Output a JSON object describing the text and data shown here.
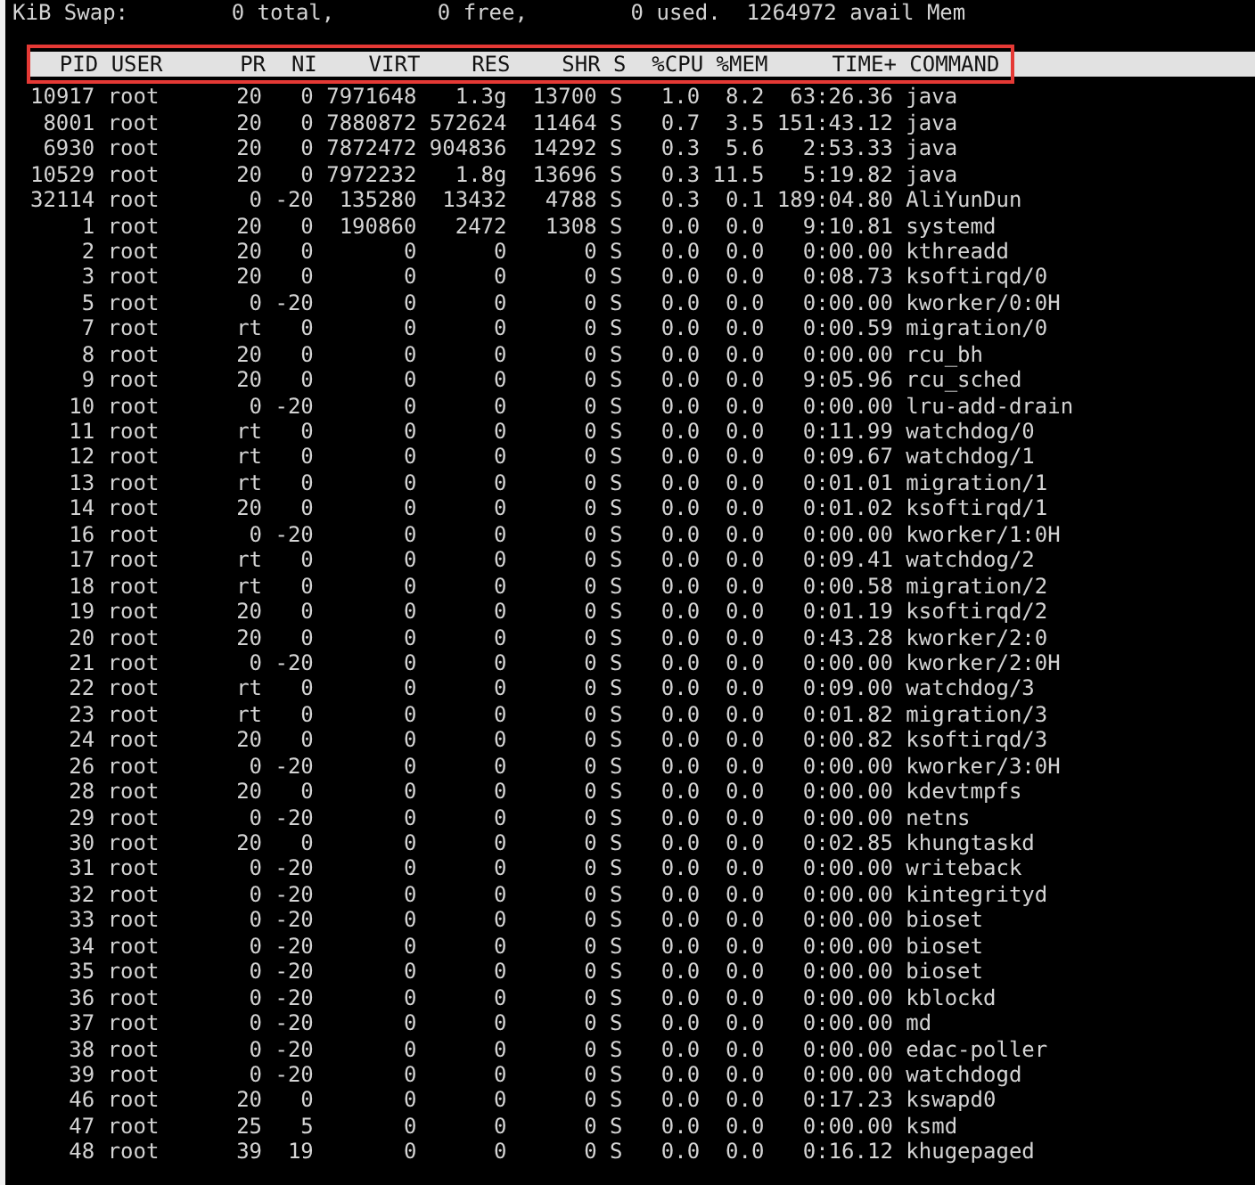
{
  "swap_line": "KiB Swap:        0 total,        0 free,        0 used.  1264972 avail Mem",
  "table": {
    "highlighted": true,
    "columns": [
      "PID",
      "USER",
      "PR",
      "NI",
      "VIRT",
      "RES",
      "SHR",
      "S",
      "%CPU",
      "%MEM",
      "TIME+",
      "COMMAND"
    ],
    "rows": [
      [
        "10917",
        "root",
        "20",
        "0",
        "7971648",
        "1.3g",
        "13700",
        "S",
        "1.0",
        "8.2",
        "63:26.36",
        "java"
      ],
      [
        "8001",
        "root",
        "20",
        "0",
        "7880872",
        "572624",
        "11464",
        "S",
        "0.7",
        "3.5",
        "151:43.12",
        "java"
      ],
      [
        "6930",
        "root",
        "20",
        "0",
        "7872472",
        "904836",
        "14292",
        "S",
        "0.3",
        "5.6",
        "2:53.33",
        "java"
      ],
      [
        "10529",
        "root",
        "20",
        "0",
        "7972232",
        "1.8g",
        "13696",
        "S",
        "0.3",
        "11.5",
        "5:19.82",
        "java"
      ],
      [
        "32114",
        "root",
        "0",
        "-20",
        "135280",
        "13432",
        "4788",
        "S",
        "0.3",
        "0.1",
        "189:04.80",
        "AliYunDun"
      ],
      [
        "1",
        "root",
        "20",
        "0",
        "190860",
        "2472",
        "1308",
        "S",
        "0.0",
        "0.0",
        "9:10.81",
        "systemd"
      ],
      [
        "2",
        "root",
        "20",
        "0",
        "0",
        "0",
        "0",
        "S",
        "0.0",
        "0.0",
        "0:00.00",
        "kthreadd"
      ],
      [
        "3",
        "root",
        "20",
        "0",
        "0",
        "0",
        "0",
        "S",
        "0.0",
        "0.0",
        "0:08.73",
        "ksoftirqd/0"
      ],
      [
        "5",
        "root",
        "0",
        "-20",
        "0",
        "0",
        "0",
        "S",
        "0.0",
        "0.0",
        "0:00.00",
        "kworker/0:0H"
      ],
      [
        "7",
        "root",
        "rt",
        "0",
        "0",
        "0",
        "0",
        "S",
        "0.0",
        "0.0",
        "0:00.59",
        "migration/0"
      ],
      [
        "8",
        "root",
        "20",
        "0",
        "0",
        "0",
        "0",
        "S",
        "0.0",
        "0.0",
        "0:00.00",
        "rcu_bh"
      ],
      [
        "9",
        "root",
        "20",
        "0",
        "0",
        "0",
        "0",
        "S",
        "0.0",
        "0.0",
        "9:05.96",
        "rcu_sched"
      ],
      [
        "10",
        "root",
        "0",
        "-20",
        "0",
        "0",
        "0",
        "S",
        "0.0",
        "0.0",
        "0:00.00",
        "lru-add-drain"
      ],
      [
        "11",
        "root",
        "rt",
        "0",
        "0",
        "0",
        "0",
        "S",
        "0.0",
        "0.0",
        "0:11.99",
        "watchdog/0"
      ],
      [
        "12",
        "root",
        "rt",
        "0",
        "0",
        "0",
        "0",
        "S",
        "0.0",
        "0.0",
        "0:09.67",
        "watchdog/1"
      ],
      [
        "13",
        "root",
        "rt",
        "0",
        "0",
        "0",
        "0",
        "S",
        "0.0",
        "0.0",
        "0:01.01",
        "migration/1"
      ],
      [
        "14",
        "root",
        "20",
        "0",
        "0",
        "0",
        "0",
        "S",
        "0.0",
        "0.0",
        "0:01.02",
        "ksoftirqd/1"
      ],
      [
        "16",
        "root",
        "0",
        "-20",
        "0",
        "0",
        "0",
        "S",
        "0.0",
        "0.0",
        "0:00.00",
        "kworker/1:0H"
      ],
      [
        "17",
        "root",
        "rt",
        "0",
        "0",
        "0",
        "0",
        "S",
        "0.0",
        "0.0",
        "0:09.41",
        "watchdog/2"
      ],
      [
        "18",
        "root",
        "rt",
        "0",
        "0",
        "0",
        "0",
        "S",
        "0.0",
        "0.0",
        "0:00.58",
        "migration/2"
      ],
      [
        "19",
        "root",
        "20",
        "0",
        "0",
        "0",
        "0",
        "S",
        "0.0",
        "0.0",
        "0:01.19",
        "ksoftirqd/2"
      ],
      [
        "20",
        "root",
        "20",
        "0",
        "0",
        "0",
        "0",
        "S",
        "0.0",
        "0.0",
        "0:43.28",
        "kworker/2:0"
      ],
      [
        "21",
        "root",
        "0",
        "-20",
        "0",
        "0",
        "0",
        "S",
        "0.0",
        "0.0",
        "0:00.00",
        "kworker/2:0H"
      ],
      [
        "22",
        "root",
        "rt",
        "0",
        "0",
        "0",
        "0",
        "S",
        "0.0",
        "0.0",
        "0:09.00",
        "watchdog/3"
      ],
      [
        "23",
        "root",
        "rt",
        "0",
        "0",
        "0",
        "0",
        "S",
        "0.0",
        "0.0",
        "0:01.82",
        "migration/3"
      ],
      [
        "24",
        "root",
        "20",
        "0",
        "0",
        "0",
        "0",
        "S",
        "0.0",
        "0.0",
        "0:00.82",
        "ksoftirqd/3"
      ],
      [
        "26",
        "root",
        "0",
        "-20",
        "0",
        "0",
        "0",
        "S",
        "0.0",
        "0.0",
        "0:00.00",
        "kworker/3:0H"
      ],
      [
        "28",
        "root",
        "20",
        "0",
        "0",
        "0",
        "0",
        "S",
        "0.0",
        "0.0",
        "0:00.00",
        "kdevtmpfs"
      ],
      [
        "29",
        "root",
        "0",
        "-20",
        "0",
        "0",
        "0",
        "S",
        "0.0",
        "0.0",
        "0:00.00",
        "netns"
      ],
      [
        "30",
        "root",
        "20",
        "0",
        "0",
        "0",
        "0",
        "S",
        "0.0",
        "0.0",
        "0:02.85",
        "khungtaskd"
      ],
      [
        "31",
        "root",
        "0",
        "-20",
        "0",
        "0",
        "0",
        "S",
        "0.0",
        "0.0",
        "0:00.00",
        "writeback"
      ],
      [
        "32",
        "root",
        "0",
        "-20",
        "0",
        "0",
        "0",
        "S",
        "0.0",
        "0.0",
        "0:00.00",
        "kintegrityd"
      ],
      [
        "33",
        "root",
        "0",
        "-20",
        "0",
        "0",
        "0",
        "S",
        "0.0",
        "0.0",
        "0:00.00",
        "bioset"
      ],
      [
        "34",
        "root",
        "0",
        "-20",
        "0",
        "0",
        "0",
        "S",
        "0.0",
        "0.0",
        "0:00.00",
        "bioset"
      ],
      [
        "35",
        "root",
        "0",
        "-20",
        "0",
        "0",
        "0",
        "S",
        "0.0",
        "0.0",
        "0:00.00",
        "bioset"
      ],
      [
        "36",
        "root",
        "0",
        "-20",
        "0",
        "0",
        "0",
        "S",
        "0.0",
        "0.0",
        "0:00.00",
        "kblockd"
      ],
      [
        "37",
        "root",
        "0",
        "-20",
        "0",
        "0",
        "0",
        "S",
        "0.0",
        "0.0",
        "0:00.00",
        "md"
      ],
      [
        "38",
        "root",
        "0",
        "-20",
        "0",
        "0",
        "0",
        "S",
        "0.0",
        "0.0",
        "0:00.00",
        "edac-poller"
      ],
      [
        "39",
        "root",
        "0",
        "-20",
        "0",
        "0",
        "0",
        "S",
        "0.0",
        "0.0",
        "0:00.00",
        "watchdogd"
      ],
      [
        "46",
        "root",
        "20",
        "0",
        "0",
        "0",
        "0",
        "S",
        "0.0",
        "0.0",
        "0:17.23",
        "kswapd0"
      ],
      [
        "47",
        "root",
        "25",
        "5",
        "0",
        "0",
        "0",
        "S",
        "0.0",
        "0.0",
        "0:00.00",
        "ksmd"
      ],
      [
        "48",
        "root",
        "39",
        "19",
        "0",
        "0",
        "0",
        "S",
        "0.0",
        "0.0",
        "0:16.12",
        "khugepaged"
      ]
    ]
  }
}
